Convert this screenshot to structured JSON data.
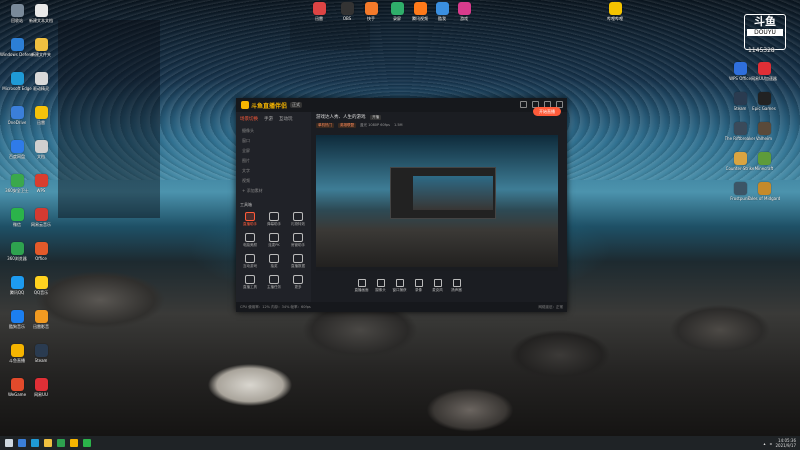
{
  "overlay": {
    "brand": "斗鱼",
    "site": "DOUYU",
    "room_id": "1145328"
  },
  "desktop": {
    "left_icons": [
      {
        "label": "回收站",
        "color": "#7a8a9a"
      },
      {
        "label": "新建文本文档",
        "color": "#e9e9e9"
      },
      {
        "label": "Windows Defender",
        "color": "#2c7fd6"
      },
      {
        "label": "新建文件夹",
        "color": "#f0c040"
      },
      {
        "label": "Microsoft Edge",
        "color": "#1f9ad6"
      },
      {
        "label": "驱动精灵",
        "color": "#d9d9d9"
      },
      {
        "label": "OneDrive",
        "color": "#3b7fd9"
      },
      {
        "label": "迅雷",
        "color": "#f5c20a"
      },
      {
        "label": "百度网盘",
        "color": "#2f7be8"
      },
      {
        "label": "文档",
        "color": "#cfcfcf"
      },
      {
        "label": "360安全卫士",
        "color": "#3aa84c"
      },
      {
        "label": "WPS",
        "color": "#d93d2e"
      },
      {
        "label": "微信",
        "color": "#2bb34a"
      },
      {
        "label": "网易云音乐",
        "color": "#d33a31"
      },
      {
        "label": "360浏览器",
        "color": "#2ea24f"
      },
      {
        "label": "Office",
        "color": "#e35a2a"
      },
      {
        "label": "腾讯QQ",
        "color": "#1d9bf0"
      },
      {
        "label": "QQ音乐",
        "color": "#ffd21f"
      },
      {
        "label": "酷狗音乐",
        "color": "#1c7ff0"
      },
      {
        "label": "迅雷影音",
        "color": "#f19a21"
      },
      {
        "label": "斗鱼直播",
        "color": "#f5b400"
      },
      {
        "label": "Steam",
        "color": "#2a3b50"
      },
      {
        "label": "WeGame",
        "color": "#e24a2b"
      },
      {
        "label": "网易UU",
        "color": "#e02f36"
      }
    ],
    "top_icons": [
      {
        "label": "迅雷",
        "color": "#d44"
      },
      {
        "label": "OBS",
        "color": "#333"
      },
      {
        "label": "快手",
        "color": "#f57a2a"
      },
      {
        "label": "录屏",
        "color": "#2fae6a"
      },
      {
        "label": "腾讯视频",
        "color": "#ff7a1a"
      },
      {
        "label": "酷我",
        "color": "#3a8fe0"
      },
      {
        "label": "游戏",
        "color": "#d83b8c"
      },
      {
        "label": "哔哩哔哩",
        "color": "#f5c400"
      }
    ],
    "right_icons": [
      {
        "label": "WPS Office",
        "color": "#2f6fdd"
      },
      {
        "label": "网易UU加速器",
        "color": "#e02f36"
      },
      {
        "label": "Steam",
        "color": "#2a3b50"
      },
      {
        "label": "Epic Games",
        "color": "#222"
      },
      {
        "label": "The Riftbreaker",
        "color": "#3a4a5a"
      },
      {
        "label": "Valheim",
        "color": "#5a4a3a"
      },
      {
        "label": "Counter-Strike",
        "color": "#d9a441"
      },
      {
        "label": "Minecraft",
        "color": "#5e9b3a"
      },
      {
        "label": "Frostpunk",
        "color": "#3c5566"
      },
      {
        "label": "Tales of Midgard",
        "color": "#c58a2a"
      }
    ]
  },
  "app": {
    "name": "斗鱼直播伴侣",
    "version": "正式",
    "sidebar_tabs": [
      "场景切换",
      "手游",
      "互动玩"
    ],
    "scene_lines": [
      "摄像头",
      "窗口",
      "全屏",
      "图片",
      "文字",
      "视频",
      "+ 添加素材"
    ],
    "tools_title": "工具箱",
    "tools": [
      {
        "label": "直播助手"
      },
      {
        "label": "弹幕助手"
      },
      {
        "label": "礼物特效"
      },
      {
        "label": "电脑美颜"
      },
      {
        "label": "连麦PK"
      },
      {
        "label": "房管助手"
      },
      {
        "label": "互动游戏"
      },
      {
        "label": "抽奖"
      },
      {
        "label": "直播数据"
      },
      {
        "label": "直播工具"
      },
      {
        "label": "主播任务"
      },
      {
        "label": "更多"
      }
    ],
    "room_title": "游戏达人秀、人生的游戏",
    "room_tag": "开播",
    "meta": {
      "category": "单机热门",
      "sub": "英雄联盟",
      "quality": "蓝光 1080P 60fps",
      "stat": "1.5M"
    },
    "bottom_tools": [
      "直播画面",
      "摄像头",
      "窗口捕获",
      "录像",
      "麦克风",
      "扬声器"
    ],
    "live_button": "开始直播",
    "status_left": "CPU 使用率：12%  内存：34%  帧率：60fps",
    "status_right": "网络延迟：正常"
  },
  "taskbar": {
    "time": "14:05:36",
    "date": "2021/9/17"
  }
}
